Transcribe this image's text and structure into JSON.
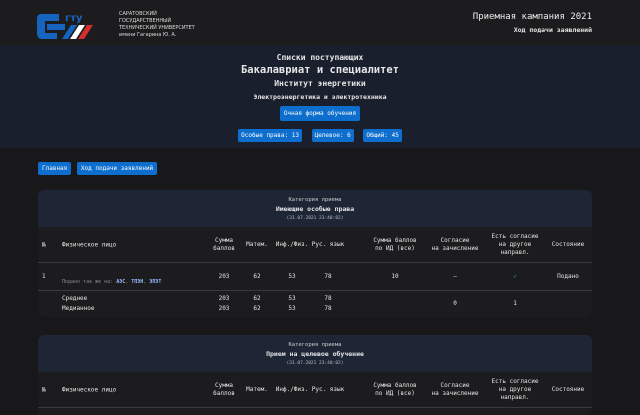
{
  "header": {
    "university": [
      "САРАТОВСКИЙ",
      "ГОСУДАРСТВЕННЫЙ",
      "ТЕХНИЧЕСКИЙ УНИВЕРСИТЕТ",
      "имени Гагарина Ю. А."
    ],
    "logo_text": "СГТУ",
    "campaign": "Приемная кампания 2021",
    "progress_link": "Ход подачи заявлений"
  },
  "hero": {
    "title": "Списки поступающих",
    "level": "Бакалавриат и специалитет",
    "institute": "Институт энергетики",
    "program": "Электроэнергетика и электротехника",
    "form_button": "Очная форма обучения",
    "counts": [
      "Особые права: 13",
      "Целевое: 6",
      "Общий: 45"
    ]
  },
  "nav": {
    "home": "Главная",
    "progress": "Ход подачи заявлений"
  },
  "columns": {
    "num": "№",
    "person": "Физическое лицо",
    "sum": [
      "Сумма",
      "баллов"
    ],
    "math": "Матем.",
    "inf": "Инф./Физ.",
    "rus": "Рус. язык",
    "id": [
      "Сумма баллов",
      "по ИД (все)"
    ],
    "consent": [
      "Согласие",
      "на зачисление"
    ],
    "other": [
      "Есть согласие",
      "на другое",
      "направл."
    ],
    "state": "Состояние"
  },
  "cards": [
    {
      "cat_label": "Категория приема",
      "category": "Имеющие особые права",
      "date": "(31.07.2021 23:40:02)",
      "rows": [
        {
          "num": "1",
          "also_label": "Подано так же на:",
          "also": [
            "АЭС",
            "ТПЭН",
            "ЭПЭТ"
          ],
          "sum": "203",
          "math": "62",
          "inf": "53",
          "rus": "78",
          "id": "10",
          "consent": "—",
          "other": "✓",
          "state": "Подано"
        }
      ],
      "avg": {
        "label": "Среднее",
        "sum": "203",
        "math": "62",
        "inf": "53",
        "rus": "78"
      },
      "median": {
        "label": "Медианное",
        "sum": "203",
        "math": "62",
        "inf": "53",
        "rus": "78"
      },
      "consent_total": "0",
      "other_total": "1"
    },
    {
      "cat_label": "Категория приема",
      "category": "Прием на целевое обучение",
      "date": "(31.07.2021 23:40:02)"
    }
  ]
}
